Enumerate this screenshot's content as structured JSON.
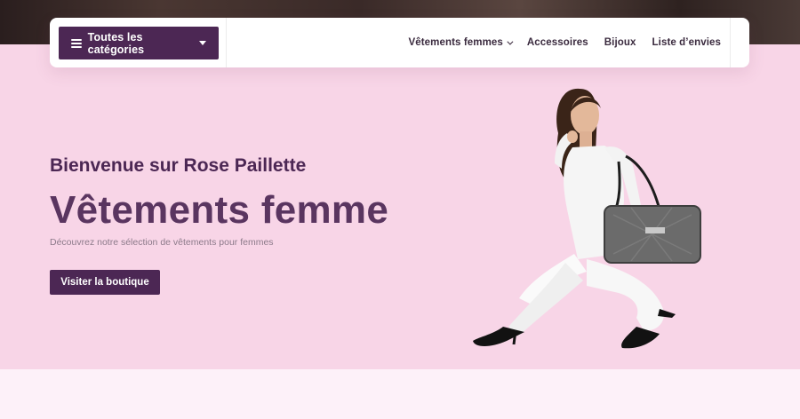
{
  "nav": {
    "categories_label": "Toutes les catégories",
    "menu": [
      {
        "label": "Vêtements femmes",
        "has_dropdown": true
      },
      {
        "label": "Accessoires",
        "has_dropdown": false
      },
      {
        "label": "Bijoux",
        "has_dropdown": false
      },
      {
        "label": "Liste d’envies",
        "has_dropdown": false
      }
    ]
  },
  "hero": {
    "welcome": "Bienvenue sur Rose Paillette",
    "headline": "Vêtements femme",
    "subtitle": "Découvrez notre sélection de vêtements pour femmes",
    "cta_label": "Visiter la boutique",
    "image_alt": "model-with-handbag"
  },
  "colors": {
    "brand": "#4c2754",
    "hero_bg": "#f8d5e7",
    "headline": "#5a3560",
    "page_bg": "#fdf1f9"
  }
}
